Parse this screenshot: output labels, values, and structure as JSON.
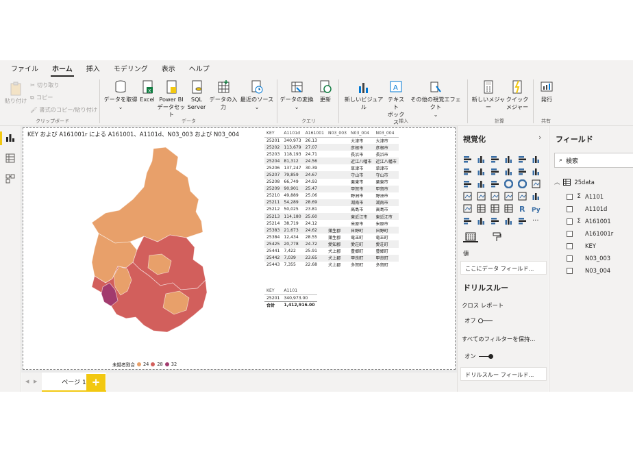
{
  "menu": {
    "tabs": [
      "ファイル",
      "ホーム",
      "挿入",
      "モデリング",
      "表示",
      "ヘルプ"
    ],
    "active": 1
  },
  "ribbon": {
    "clipboard": {
      "paste": "貼り付け",
      "cut": "切り取り",
      "copy": "コピー",
      "format_painter": "書式のコピー/貼り付け",
      "group": "クリップボード"
    },
    "data": {
      "get_data": "データを取得",
      "excel": "Excel",
      "pbi_line1": "Power BI",
      "pbi_line2": "データセット",
      "sql_line1": "SQL",
      "sql_line2": "Server",
      "enter_data": "データの入力",
      "recent": "最近のソース",
      "group": "データ"
    },
    "query": {
      "transform": "データの変換",
      "refresh": "更新",
      "group": "クエリ"
    },
    "insert": {
      "new_visual": "新しいビジュアル",
      "textbox_line1": "テキスト",
      "textbox_line2": "ボックス",
      "more_visuals": "その他の視覚エフェクト",
      "group": "挿入"
    },
    "calc": {
      "new_measure": "新しいメジャー",
      "quick_line1": "クイック",
      "quick_line2": "メジャー",
      "group": "計算"
    },
    "share": {
      "publish": "発行",
      "group": "共有"
    }
  },
  "visual": {
    "title": "KEY および A161001r による A161001、A1101d、N03_003 および N03_004",
    "legend": {
      "label": "未婚者割合",
      "items": [
        {
          "value": "24",
          "color": "#e8a06a"
        },
        {
          "value": "28",
          "color": "#d25f5c"
        },
        {
          "value": "32",
          "color": "#a23b6e"
        }
      ]
    }
  },
  "table1": {
    "headers": [
      "KEY",
      "A1101d",
      "A161001",
      "N03_003",
      "N03_004",
      "N03_004"
    ],
    "rows": [
      [
        "25201",
        "340,973",
        "26.13",
        "",
        "大津市",
        "大津市"
      ],
      [
        "25202",
        "113,679",
        "27.07",
        "",
        "彦根市",
        "彦根市"
      ],
      [
        "25203",
        "118,193",
        "24.71",
        "",
        "長浜市",
        "長浜市"
      ],
      [
        "25204",
        "81,312",
        "24.56",
        "",
        "近江八幡市",
        "近江八幡市"
      ],
      [
        "25206",
        "137,247",
        "30.39",
        "",
        "草津市",
        "草津市"
      ],
      [
        "25207",
        "79,859",
        "24.67",
        "",
        "守山市",
        "守山市"
      ],
      [
        "25208",
        "66,749",
        "24.93",
        "",
        "栗東市",
        "栗東市"
      ],
      [
        "25209",
        "90,901",
        "25.47",
        "",
        "甲賀市",
        "甲賀市"
      ],
      [
        "25210",
        "49,889",
        "25.06",
        "",
        "野洲市",
        "野洲市"
      ],
      [
        "25211",
        "54,289",
        "28.69",
        "",
        "湖南市",
        "湖南市"
      ],
      [
        "25212",
        "50,025",
        "23.81",
        "",
        "高島市",
        "高島市"
      ],
      [
        "25213",
        "114,180",
        "25.60",
        "",
        "東近江市",
        "東近江市"
      ],
      [
        "25214",
        "38,719",
        "24.12",
        "",
        "米原市",
        "米原市"
      ],
      [
        "25383",
        "21,673",
        "24.62",
        "蒲生郡",
        "日野町",
        "日野町"
      ],
      [
        "25384",
        "12,434",
        "28.55",
        "蒲生郡",
        "竜王町",
        "竜王町"
      ],
      [
        "25425",
        "20,778",
        "24.72",
        "愛知郡",
        "愛荘町",
        "愛荘町"
      ],
      [
        "25441",
        "7,422",
        "25.91",
        "犬上郡",
        "豊郷町",
        "豊郷町"
      ],
      [
        "25442",
        "7,039",
        "23.65",
        "犬上郡",
        "甲良町",
        "甲良町"
      ],
      [
        "25443",
        "7,355",
        "22.68",
        "犬上郡",
        "多賀町",
        "多賀町"
      ]
    ]
  },
  "table2": {
    "headers": [
      "KEY",
      "A1101"
    ],
    "rows": [
      [
        "25201",
        "340,973.00"
      ]
    ],
    "total": [
      "合計",
      "1,412,916.00"
    ]
  },
  "pages": {
    "tab": "ページ 1",
    "add": "+"
  },
  "viz_pane": {
    "title": "視覚化",
    "values_label": "値",
    "values_well": "ここにデータ フィールド...",
    "drill_title": "ドリルスルー",
    "cross_report": "クロス レポート",
    "off_label": "オフ",
    "keep_filters": "すべてのフィルターを保持...",
    "on_label": "オン",
    "drill_well": "ドリルスルー フィールド...",
    "icons": [
      "stacked-bar-icon",
      "stacked-column-icon",
      "clustered-bar-icon",
      "clustered-column-icon",
      "100-bar-icon",
      "100-column-icon",
      "line-chart-icon",
      "area-chart-icon",
      "stacked-area-icon",
      "line-column-icon",
      "line-clustered-icon",
      "ribbon-chart-icon",
      "waterfall-icon",
      "funnel-icon",
      "scatter-icon",
      "pie-chart-icon",
      "donut-chart-icon",
      "treemap-icon",
      "map-icon",
      "filled-map-icon",
      "shape-map-icon",
      "gauge-icon",
      "card-icon",
      "multirow-card-icon",
      "kpi-icon",
      "slicer-icon",
      "table-icon",
      "matrix-icon",
      "r-visual-icon",
      "python-visual-icon",
      "key-influencers-icon",
      "decomposition-tree-icon",
      "qa-icon",
      "smart-narrative-icon",
      "paginated-icon",
      "more-visuals-icon"
    ]
  },
  "fields_pane": {
    "title": "フィールド",
    "search_placeholder": "検索",
    "table_name": "25data",
    "fields": [
      {
        "name": "A1101",
        "sigma": true
      },
      {
        "name": "A1101d",
        "sigma": false
      },
      {
        "name": "A161001",
        "sigma": true
      },
      {
        "name": "A161001r",
        "sigma": false
      },
      {
        "name": "KEY",
        "sigma": false
      },
      {
        "name": "N03_003",
        "sigma": false
      },
      {
        "name": "N03_004",
        "sigma": false
      }
    ]
  },
  "colors": {
    "accent": "#f2c811",
    "light": "#e8a06a",
    "mid": "#d25f5c",
    "dark": "#a23b6e"
  }
}
